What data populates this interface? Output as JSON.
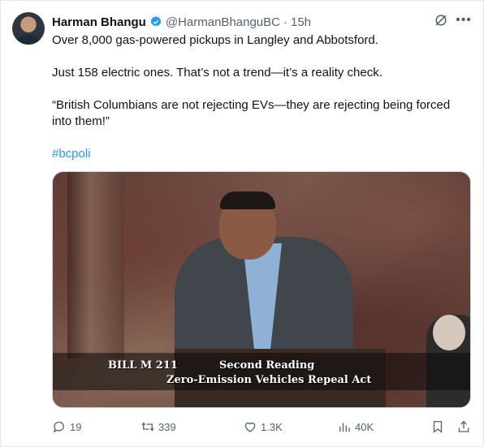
{
  "author": {
    "name": "Harman Bhangu",
    "handle": "@HarmanBhanguBC",
    "separator": "·",
    "time": "15h"
  },
  "tweet": {
    "line1": "Over 8,000 gas-powered pickups in Langley and Abbotsford.",
    "line2": "Just 158 electric ones. That’s not a trend—it’s a reality check.",
    "line3a": "“British Columbians are not rejecting EVs—they are rejecting being forced",
    "line3b": "into them!”",
    "hashtag": "#bcpoli"
  },
  "media": {
    "caption_bill": "BILL M 211",
    "caption_reading": "Second Reading",
    "caption_act": "Zero-Emission Vehicles Repeal Act"
  },
  "actions": {
    "replies": "19",
    "retweets": "339",
    "likes": "1.3K",
    "views": "40K"
  },
  "icons": {
    "verified": "verified-badge-icon",
    "grok": "grok-icon",
    "more": "more-icon",
    "reply": "reply-icon",
    "retweet": "retweet-icon",
    "like": "heart-icon",
    "views": "views-icon",
    "bookmark": "bookmark-icon",
    "share": "share-icon"
  },
  "colors": {
    "accent": "#1d9bf0",
    "secondary_text": "#536471"
  }
}
